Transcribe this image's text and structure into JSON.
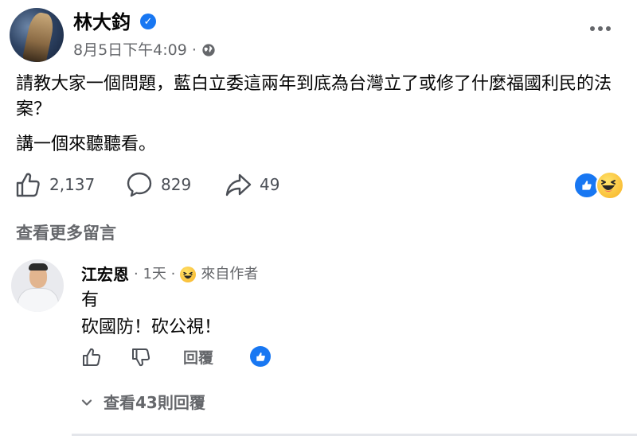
{
  "post": {
    "author": "林大鈞",
    "verified_mark": "✓",
    "time": "8月5日下午4:09",
    "separator": "·",
    "body_line1": "請教大家一個問題，藍白立委這兩年到底為台灣立了或修了什麼福國利民的法案？",
    "body_line2": "講一個來聽聽看。"
  },
  "actions": {
    "likes": "2,137",
    "comments": "829",
    "shares": "49"
  },
  "reactions": [
    "like-icon",
    "haha-icon"
  ],
  "comments_section": {
    "view_more": "查看更多留言"
  },
  "comment": {
    "name": "江宏恩",
    "time": "· 1天 ·",
    "author_label": "來自作者",
    "line1": "有",
    "line2": "砍國防！砍公視！",
    "reply_label": "回覆",
    "view_replies": "查看43則回覆"
  },
  "colors": {
    "accent": "#1877f2",
    "secondary_text": "#65676b",
    "primary_text": "#050505"
  }
}
